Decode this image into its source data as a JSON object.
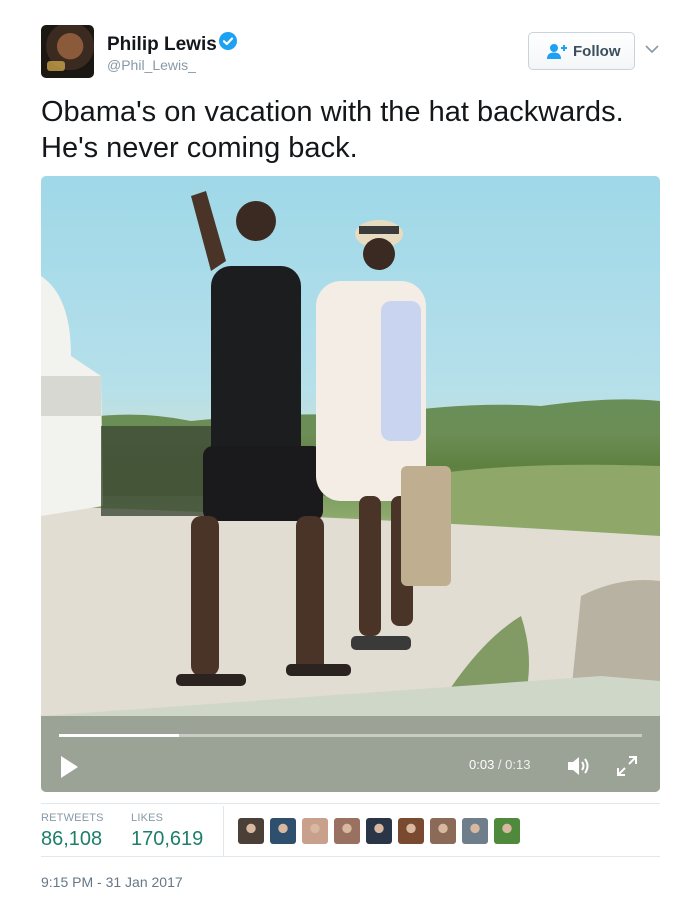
{
  "author": {
    "name": "Philip Lewis",
    "handle": "@Phil_Lewis_",
    "verified": true
  },
  "follow": {
    "label": "Follow"
  },
  "tweet": {
    "lines": [
      "Obama's on vacation with the hat backwards.",
      "He's never coming back."
    ]
  },
  "video": {
    "current_time": "0:03",
    "separator": " / ",
    "duration": "0:13",
    "progress_fraction": 0.205
  },
  "stats": {
    "retweets_label": "RETWEETS",
    "retweets_value": "86,108",
    "likes_label": "LIKES",
    "likes_value": "170,619"
  },
  "liker_avatars": [
    "#4a4038",
    "#2f4f6f",
    "#c8a08c",
    "#9a7060",
    "#2b3548",
    "#7a4a30",
    "#8c6a58",
    "#6e7e8a",
    "#4f8a3c"
  ],
  "timestamp": "9:15 PM - 31 Jan 2017",
  "colors": {
    "verified": "#1da1f2",
    "stat_value": "#1e7f6a",
    "muted": "#8899a6"
  }
}
